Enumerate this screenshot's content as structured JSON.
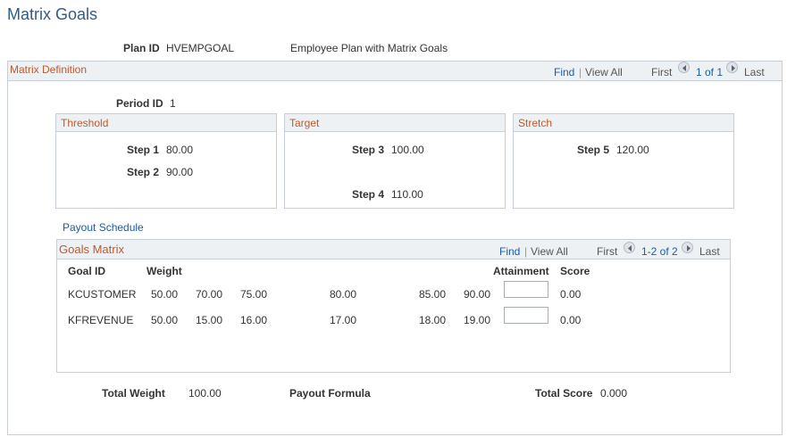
{
  "page": {
    "title": "Matrix Goals"
  },
  "plan": {
    "label": "Plan ID",
    "value": "HVEMPGOAL",
    "description": "Employee Plan with Matrix Goals"
  },
  "matrix_definition": {
    "title": "Matrix Definition",
    "nav": {
      "find": "Find",
      "sep": "|",
      "view_all": "View All",
      "first": "First",
      "range": "1 of 1",
      "last": "Last"
    },
    "period_label": "Period ID",
    "period_value": "1",
    "groups": [
      {
        "title": "Threshold",
        "steps": [
          {
            "label": "Step 1",
            "value": "80.00"
          },
          {
            "label": "Step 2",
            "value": "90.00"
          }
        ]
      },
      {
        "title": "Target",
        "steps": [
          {
            "label": "Step 3",
            "value": "100.00"
          },
          {
            "label": "Step 4",
            "value": "110.00"
          }
        ]
      },
      {
        "title": "Stretch",
        "steps": [
          {
            "label": "Step 5",
            "value": "120.00"
          }
        ]
      }
    ]
  },
  "payout_schedule_link": "Payout Schedule",
  "goals_matrix": {
    "title": "Goals Matrix",
    "nav": {
      "find": "Find",
      "sep": "|",
      "view_all": "View All",
      "first": "First",
      "range": "1-2 of 2",
      "last": "Last"
    },
    "headers": {
      "goal_id": "Goal ID",
      "weight": "Weight",
      "attainment": "Attainment",
      "score": "Score"
    },
    "rows": [
      {
        "goal_id": "KCUSTOMER",
        "weight": "50.00",
        "v1": "70.00",
        "v2": "75.00",
        "v3": "80.00",
        "v4": "85.00",
        "v5": "90.00",
        "attainment": "",
        "score": "0.00"
      },
      {
        "goal_id": "KFREVENUE",
        "weight": "50.00",
        "v1": "15.00",
        "v2": "16.00",
        "v3": "17.00",
        "v4": "18.00",
        "v5": "19.00",
        "attainment": "",
        "score": "0.00"
      }
    ]
  },
  "footer": {
    "total_weight_label": "Total Weight",
    "total_weight_value": "100.00",
    "payout_formula_label": "Payout Formula",
    "total_score_label": "Total Score",
    "total_score_value": "0.000"
  }
}
